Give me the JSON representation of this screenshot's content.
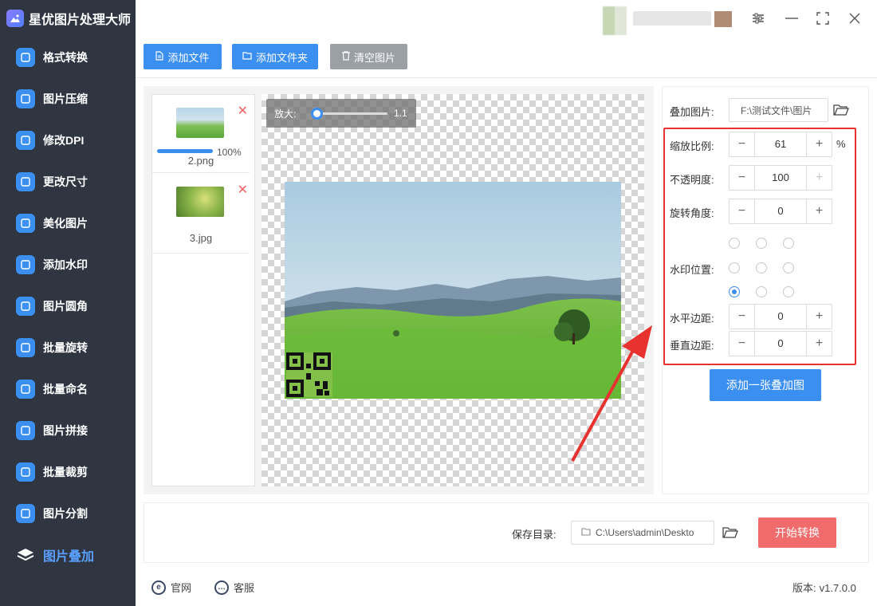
{
  "app": {
    "title": "星优图片处理大师"
  },
  "sidebar": {
    "items": [
      {
        "label": "格式转换",
        "icon": "format-convert-icon",
        "color": "#3a8ff0"
      },
      {
        "label": "图片压缩",
        "icon": "compress-icon",
        "color": "#3a8ff0"
      },
      {
        "label": "修改DPI",
        "icon": "dpi-icon",
        "color": "#3a8ff0"
      },
      {
        "label": "更改尺寸",
        "icon": "resize-icon",
        "color": "#3a8ff0"
      },
      {
        "label": "美化图片",
        "icon": "beautify-icon",
        "color": "#3a8ff0"
      },
      {
        "label": "添加水印",
        "icon": "watermark-icon",
        "color": "#3a8ff0"
      },
      {
        "label": "图片圆角",
        "icon": "rounded-corner-icon",
        "color": "#3a8ff0"
      },
      {
        "label": "批量旋转",
        "icon": "rotate-icon",
        "color": "#3a8ff0"
      },
      {
        "label": "批量命名",
        "icon": "rename-icon",
        "color": "#3a8ff0"
      },
      {
        "label": "图片拼接",
        "icon": "stitch-icon",
        "color": "#3a8ff0"
      },
      {
        "label": "批量裁剪",
        "icon": "crop-icon",
        "color": "#3a8ff0"
      },
      {
        "label": "图片分割",
        "icon": "split-icon",
        "color": "#3a8ff0"
      },
      {
        "label": "图片叠加",
        "icon": "overlay-icon",
        "color": "#5aa0ff",
        "active": true
      }
    ]
  },
  "toolbar": {
    "add_file": "添加文件",
    "add_folder": "添加文件夹",
    "clear_images": "清空图片"
  },
  "files": [
    {
      "name": "2.png",
      "progress_percent": 100,
      "progress_label": "100%"
    },
    {
      "name": "3.jpg"
    }
  ],
  "preview": {
    "zoom_label": "放大:",
    "zoom_value": "1.1"
  },
  "settings": {
    "overlay_image_label": "叠加图片:",
    "overlay_image_path": "F:\\测试文件\\图片",
    "scale_label": "缩放比例:",
    "scale_value": "61",
    "scale_unit": "%",
    "opacity_label": "不透明度:",
    "opacity_value": "100",
    "rotation_label": "旋转角度:",
    "rotation_value": "0",
    "position_label": "水印位置:",
    "position_selected": "bottom-left",
    "h_margin_label": "水平边距:",
    "h_margin_value": "0",
    "v_margin_label": "垂直边距:",
    "v_margin_value": "0",
    "add_overlay_button": "添加一张叠加图"
  },
  "bottom": {
    "save_dir_label": "保存目录:",
    "save_dir_path": "C:\\Users\\admin\\Deskto",
    "start_button": "开始转换"
  },
  "footer": {
    "website": "官网",
    "support": "客服",
    "version_label": "版本:",
    "version_value": "v1.7.0.0"
  },
  "colors": {
    "accent": "#3a8ff0",
    "danger": "#f06b6b",
    "sidebar_bg": "#2f3541",
    "highlight_box": "#e8322f",
    "annotation_arrow": "#e8322f"
  }
}
